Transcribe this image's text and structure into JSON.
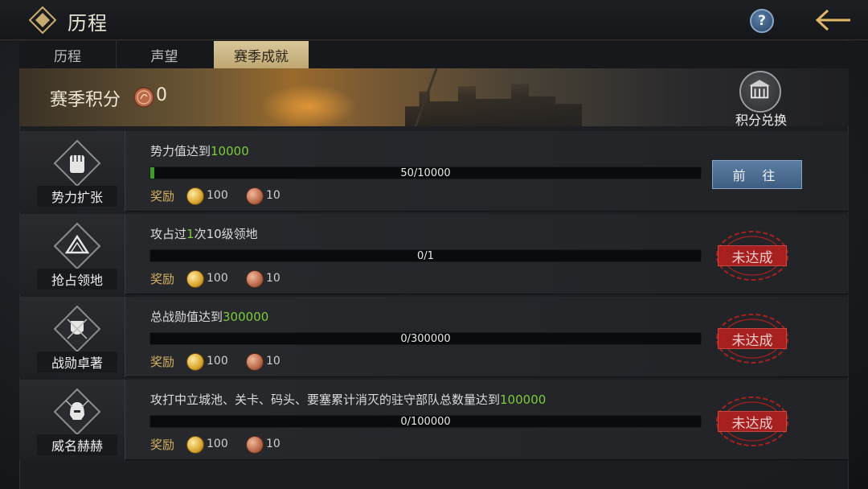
{
  "header": {
    "title": "历程"
  },
  "tabs": [
    {
      "label": "历程"
    },
    {
      "label": "声望"
    },
    {
      "label": "赛季成就",
      "active": true
    }
  ],
  "banner": {
    "points_label": "赛季积分",
    "points_value": "0",
    "exchange_label": "积分兑换"
  },
  "reward_label": "奖励",
  "rows": [
    {
      "category": "势力扩张",
      "desc_prefix": "势力值达到",
      "desc_highlight": "10000",
      "desc_suffix": "",
      "progress_text": "50/10000",
      "progress": 0.005,
      "reward_gold": "100",
      "reward_bronze": "10",
      "action": "前 往",
      "status": "go"
    },
    {
      "category": "抢占领地",
      "desc_prefix": "攻占过",
      "desc_highlight": "1",
      "desc_suffix": "次10级领地",
      "progress_text": "0/1",
      "progress": 0,
      "reward_gold": "100",
      "reward_bronze": "10",
      "action": "未达成",
      "status": "stamp"
    },
    {
      "category": "战勋卓著",
      "desc_prefix": "总战勋值达到",
      "desc_highlight": "300000",
      "desc_suffix": "",
      "progress_text": "0/300000",
      "progress": 0,
      "reward_gold": "100",
      "reward_bronze": "10",
      "action": "未达成",
      "status": "stamp"
    },
    {
      "category": "威名赫赫",
      "desc_prefix": "攻打中立城池、关卡、码头、要塞累计消灭的驻守部队总数量达到",
      "desc_highlight": "100000",
      "desc_suffix": "",
      "progress_text": "0/100000",
      "progress": 0,
      "reward_gold": "100",
      "reward_bronze": "10",
      "action": "未达成",
      "status": "stamp"
    }
  ],
  "colors": {
    "highlight": "#7ecb3b",
    "progress_fill": "#3f9b2e",
    "go_button": "#4e6f94",
    "stamp_red": "#b4201e",
    "active_tab": "#cbb583"
  }
}
